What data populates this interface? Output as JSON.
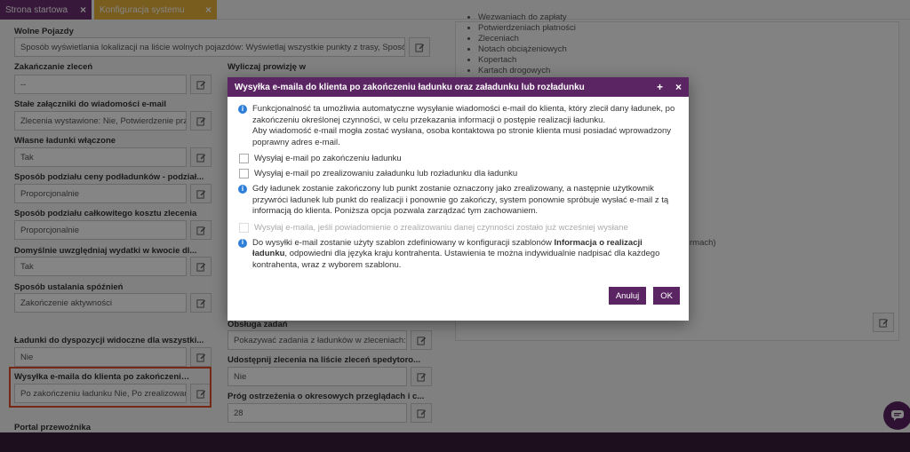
{
  "tabs": [
    {
      "label": "Strona startowa"
    },
    {
      "label": "Konfiguracja systemu"
    }
  ],
  "left_fields": [
    {
      "label": "Wolne Pojazdy",
      "value": "Sposób wyświetlania lokalizacji na liście wolnych pojazdów: Wyświetlaj wszystkie punkty z trasy, Sposób"
    },
    {
      "label": "Zakańczanie zleceń",
      "value": "--"
    },
    {
      "label": "Stałe załączniki do wiadomości e-mail",
      "value": "Zlecenia wystawione: Nie, Potwierdzenie przy"
    },
    {
      "label": "Własne ładunki włączone",
      "value": "Tak"
    },
    {
      "label": "Sposób podziału ceny podładunków - podział...",
      "value": "Proporcjonalnie"
    },
    {
      "label": "Sposób podziału całkowitego kosztu zlecenia",
      "value": "Proporcjonalnie"
    },
    {
      "label": "Domyślnie uwzględniaj wydatki w kwocie dl...",
      "value": "Tak"
    },
    {
      "label": "Sposób ustalania spóźnień",
      "value": "Zakończenie aktywności"
    },
    {
      "label": "Ładunki do dyspozycji widoczne dla wszystki...",
      "value": "Nie"
    },
    {
      "label": "Wysyłka e-maila do klienta po zakończeniu ł...",
      "value": "Po zakończeniu ładunku Nie, Po zrealizowani"
    },
    {
      "label": "Portal przewoźnika",
      "value": ""
    }
  ],
  "mid_fields": [
    {
      "label": "Wyliczaj prowizję w",
      "value": ""
    },
    {
      "label": "Obsługa zadań",
      "value": "Pokazywać zadania z ładunków w zleceniach: Ta"
    },
    {
      "label": "Udostępnij zlecenia na liście zleceń spedytoro...",
      "value": "Nie"
    },
    {
      "label": "Próg ostrzeżenia o okresowych przeglądach i c...",
      "value": "28"
    }
  ],
  "right_list": [
    "Wezwaniach do zapłaty",
    "Potwierdzeniach płatności",
    "Zleceniach",
    "Notach obciążeniowych",
    "Kopertach",
    "Kartach drogowych"
  ],
  "right_fragment": "rmach)",
  "modal": {
    "title": "Wysyłka e-maila do klienta po zakończeniu ładunku oraz załadunku lub rozładunku",
    "plus": "+",
    "close": "×",
    "info1": "Funkcjonalność ta umożliwia automatyczne wysyłanie wiadomości e-mail do klienta, który zlecił dany ładunek, po zakończeniu określonej czynności, w celu przekazania informacji o postępie realizacji ładunku.",
    "info1b": "Aby wiadomość e-mail mogła zostać wysłana, osoba kontaktowa po stronie klienta musi posiadać wprowadzony poprawny adres e-mail.",
    "check1": "Wysyłaj e-mail po zakończeniu ładunku",
    "check2": "Wysyłaj e-mail po zrealizowaniu załadunku lub rozładunku dla ładunku",
    "info2": "Gdy ładunek zostanie zakończony lub punkt zostanie oznaczony jako zrealizowany, a następnie użytkownik przywróci ładunek lub punkt do realizacji i ponownie go zakończy, system ponownie spróbuje wysłać e-mail z tą informacją do klienta. Poniższa opcja pozwala zarządzać tym zachowaniem.",
    "check3": "Wysyłaj e-maila, jeśli powiadomienie o zrealizowaniu danej czynności zostało już wcześniej wysłane",
    "info3_pre": "Do wysyłki e-mail zostanie użyty szablon zdefiniowany w konfiguracji szablonów ",
    "info3_bold": "Informacja o realizacji ładunku",
    "info3_post": ", odpowiedni dla języka kraju kontrahenta. Ustawienia te można indywidualnie nadpisać dla każdego kontrahenta, wraz z wyborem szablonu.",
    "cancel": "Anuluj",
    "ok": "OK"
  },
  "colors": {
    "accent": "#5b2463",
    "highlight": "#e24b2a",
    "tab2": "#e8b23a",
    "info": "#2f7fd8"
  }
}
